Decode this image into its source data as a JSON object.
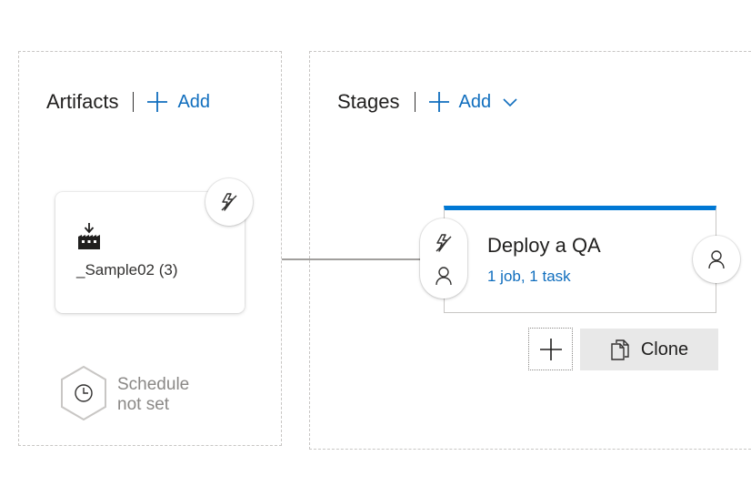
{
  "artifacts": {
    "title": "Artifacts",
    "add_label": "Add",
    "items": [
      {
        "name": "_Sample02 (3)",
        "icon": "build-artifact-icon"
      }
    ],
    "schedule": {
      "line1": "Schedule",
      "line2": "not set",
      "icon": "clock-icon"
    }
  },
  "stages": {
    "title": "Stages",
    "add_label": "Add",
    "items": [
      {
        "name": "Deploy a QA",
        "summary": "1 job, 1 task",
        "accent": "#0078d4"
      }
    ],
    "clone_label": "Clone"
  },
  "colors": {
    "accent": "#0078d4",
    "link": "#106ebe"
  }
}
